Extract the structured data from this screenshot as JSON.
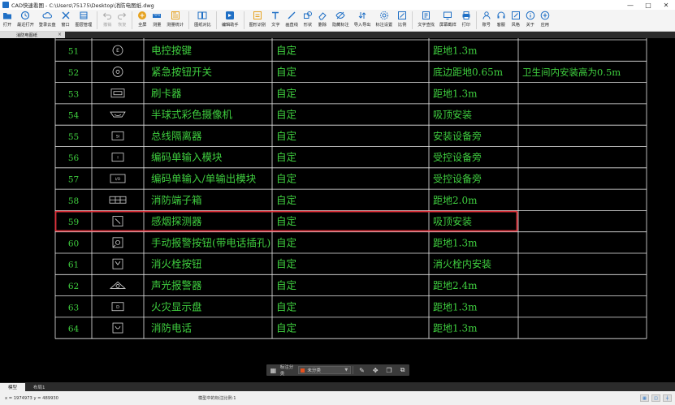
{
  "window": {
    "title": "CAD快速看图 - C:\\Users\\75175\\Desktop\\消防电图纸.dwg",
    "controls": [
      "—",
      "□",
      "✕"
    ]
  },
  "toolbar": [
    {
      "id": "open",
      "label": "打开",
      "icon": "folder-icon",
      "color": "#1f6fc5"
    },
    {
      "id": "recent",
      "label": "最近打开",
      "icon": "clock-icon",
      "color": "#1f6fc5"
    },
    {
      "id": "cloud",
      "label": "登录云盘",
      "icon": "cloud-icon",
      "color": "#1f6fc5"
    },
    {
      "id": "window",
      "label": "窗口",
      "icon": "window-icon",
      "color": "#1f6fc5"
    },
    {
      "id": "layers",
      "label": "图层管理",
      "icon": "layers-icon",
      "color": "#1f6fc5"
    },
    {
      "id": "undo",
      "label": "撤销",
      "icon": "undo-icon",
      "color": "#aaaaaa",
      "disabled": true
    },
    {
      "id": "redo",
      "label": "恢复",
      "icon": "redo-icon",
      "color": "#aaaaaa",
      "disabled": true
    },
    {
      "id": "fullscreen",
      "label": "全屏",
      "icon": "fullscreen-icon",
      "color": "#e6a21f"
    },
    {
      "id": "measure",
      "label": "测量",
      "icon": "ruler-icon",
      "color": "#1f6fc5"
    },
    {
      "id": "measure-stats",
      "label": "测量统计",
      "icon": "stats-icon",
      "color": "#e6a21f"
    },
    {
      "id": "compare",
      "label": "图纸对比",
      "icon": "compare-icon",
      "color": "#1f6fc5"
    },
    {
      "id": "assistant",
      "label": "编辑助手",
      "icon": "assistant-icon",
      "color": "#1f6fc5"
    },
    {
      "id": "recognize",
      "label": "图形识别",
      "icon": "recognize-icon",
      "color": "#e6a21f"
    },
    {
      "id": "text",
      "label": "文字",
      "icon": "text-icon",
      "color": "#1f6fc5"
    },
    {
      "id": "line",
      "label": "画直线",
      "icon": "line-icon",
      "color": "#1f6fc5"
    },
    {
      "id": "shape",
      "label": "形状",
      "icon": "shape-icon",
      "color": "#1f6fc5"
    },
    {
      "id": "delete",
      "label": "删除",
      "icon": "eraser-icon",
      "color": "#1f6fc5"
    },
    {
      "id": "hide-marks",
      "label": "隐藏标注",
      "icon": "hide-icon",
      "color": "#1f6fc5"
    },
    {
      "id": "import-export",
      "label": "导入导出",
      "icon": "import-export-icon",
      "color": "#1f6fc5"
    },
    {
      "id": "mark-settings",
      "label": "标注设置",
      "icon": "settings-icon",
      "color": "#1f6fc5"
    },
    {
      "id": "scale",
      "label": "比例",
      "icon": "scale-icon",
      "color": "#1f6fc5"
    },
    {
      "id": "find-text",
      "label": "文字查找",
      "icon": "find-icon",
      "color": "#1f6fc5"
    },
    {
      "id": "screen-export",
      "label": "屏幕截样",
      "icon": "screenshot-icon",
      "color": "#1f6fc5"
    },
    {
      "id": "print",
      "label": "打印",
      "icon": "print-icon",
      "color": "#1f6fc5"
    },
    {
      "id": "account",
      "label": "账号",
      "icon": "user-icon",
      "color": "#1f6fc5"
    },
    {
      "id": "service",
      "label": "客服",
      "icon": "headset-icon",
      "color": "#1f6fc5"
    },
    {
      "id": "style",
      "label": "风格",
      "icon": "style-icon",
      "color": "#1f6fc5"
    },
    {
      "id": "about",
      "label": "关于",
      "icon": "info-icon",
      "color": "#1f6fc5"
    },
    {
      "id": "apps",
      "label": "应用",
      "icon": "apps-icon",
      "color": "#1f6fc5"
    }
  ],
  "doc_tab": {
    "label": "消防电图纸",
    "close": "×"
  },
  "colors": {
    "cad_line": "#e8e8e8",
    "cad_text": "#3fcf3f",
    "cad_symbol": "#d8d8d8",
    "highlight": "#e0303a",
    "background": "#000000"
  },
  "table": {
    "rows": [
      {
        "no": "51",
        "symbol": "button-e",
        "name": "电控按键",
        "mode": "自定",
        "install": "距地1.3m",
        "note": ""
      },
      {
        "no": "52",
        "symbol": "circle-dot",
        "name": "紧急按钮开关",
        "mode": "自定",
        "install": "底边距地0.65m",
        "note": "卫生间内安装高为0.5m"
      },
      {
        "no": "53",
        "symbol": "card-reader",
        "name": "刷卡器",
        "mode": "自定",
        "install": "距地1.3m",
        "note": ""
      },
      {
        "no": "54",
        "symbol": "dome-camera",
        "name": "半球式彩色摄像机",
        "mode": "自定",
        "install": "吸顶安装",
        "note": ""
      },
      {
        "no": "55",
        "symbol": "box-si",
        "name": "总线隔离器",
        "mode": "自定",
        "install": "安装设备旁",
        "note": ""
      },
      {
        "no": "56",
        "symbol": "box-i",
        "name": "编码单输入模块",
        "mode": "自定",
        "install": "受控设备旁",
        "note": ""
      },
      {
        "no": "57",
        "symbol": "box-io",
        "name": "编码单输入/单输出模块",
        "mode": "自定",
        "install": "受控设备旁",
        "note": ""
      },
      {
        "no": "58",
        "symbol": "terminal-box",
        "name": "消防端子箱",
        "mode": "自定",
        "install": "距地2.0m",
        "note": ""
      },
      {
        "no": "59",
        "symbol": "smoke-detector",
        "name": "感烟探测器",
        "mode": "自定",
        "install": "吸顶安装",
        "note": "",
        "highlight": true
      },
      {
        "no": "60",
        "symbol": "manual-alarm",
        "name": "手动报警按钮(带电话插孔)",
        "mode": "自定",
        "install": "距地1.3m",
        "note": ""
      },
      {
        "no": "61",
        "symbol": "hydrant-button",
        "name": "消火栓按钮",
        "mode": "自定",
        "install": "消火栓内安装",
        "note": ""
      },
      {
        "no": "62",
        "symbol": "sound-light",
        "name": "声光报警器",
        "mode": "自定",
        "install": "距地2.4m",
        "note": ""
      },
      {
        "no": "63",
        "symbol": "fire-display",
        "name": "火灾显示盘",
        "mode": "自定",
        "install": "距地1.3m",
        "note": ""
      },
      {
        "no": "64",
        "symbol": "fire-phone",
        "name": "消防电话",
        "mode": "自定",
        "install": "距地1.3m",
        "note": ""
      }
    ]
  },
  "floatbar": {
    "label": "标注分类",
    "select_value": "未分类"
  },
  "bottom_tabs": [
    {
      "label": "模型",
      "active": true
    },
    {
      "label": "布局1",
      "active": false
    }
  ],
  "status": {
    "coords": "x = 1974973   y = 489930",
    "scale_text": "模型中的标注比例:1"
  }
}
